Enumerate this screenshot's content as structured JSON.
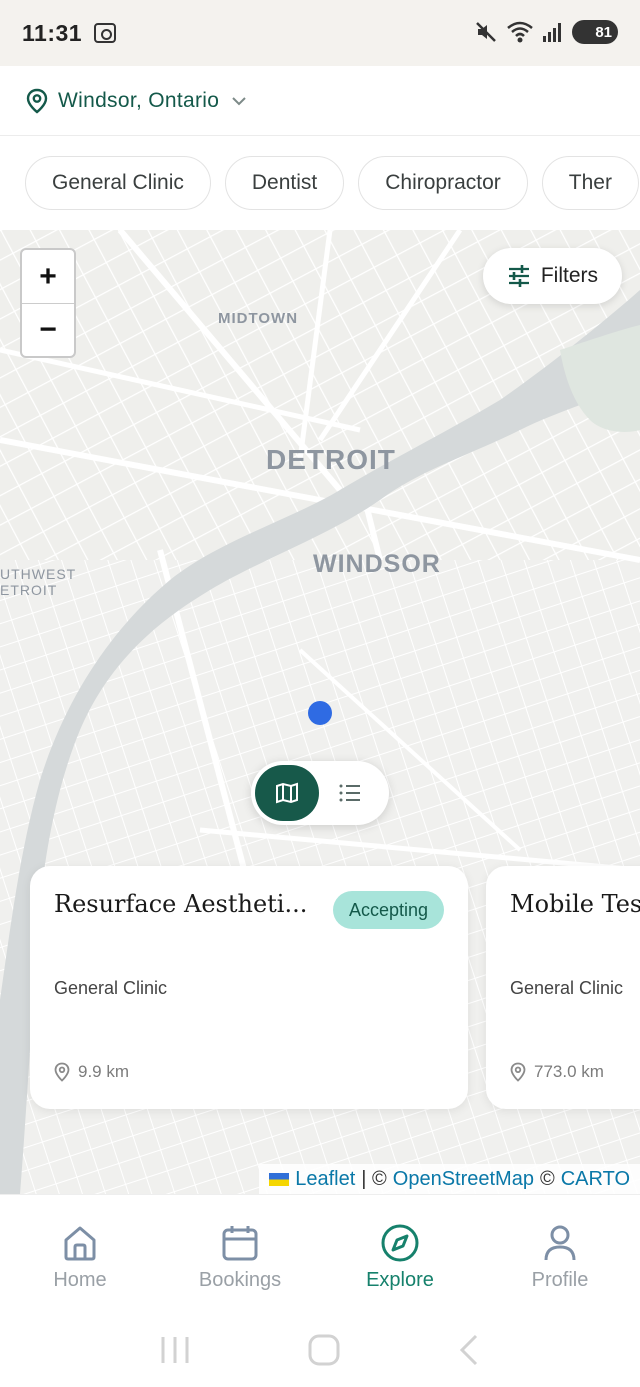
{
  "status_bar": {
    "time": "11:31",
    "battery": "81",
    "icons": [
      "screenshot-icon",
      "mute-icon",
      "wifi-icon",
      "signal-icon",
      "battery-icon"
    ]
  },
  "location": {
    "label": "Windsor, Ontario",
    "icon": "location-pin-icon",
    "accent": "#14594a"
  },
  "categories": [
    "General Clinic",
    "Dentist",
    "Chiropractor",
    "Ther"
  ],
  "map": {
    "labels": {
      "midtown": "MIDTOWN",
      "detroit": "DETROIT",
      "windsor": "WINDSOR",
      "southwest_1": "UTHWEST",
      "southwest_2": "ETROIT"
    },
    "zoom_in": "+",
    "zoom_out": "−",
    "filters_label": "Filters",
    "attribution": {
      "leaflet": "Leaflet",
      "sep1": "| ©",
      "osm": "OpenStreetMap",
      "sep2": "©",
      "carto": "CARTO"
    }
  },
  "cards": [
    {
      "title": "Resurface Aestheti...",
      "badge": "Accepting",
      "type": "General Clinic",
      "distance": "9.9 km"
    },
    {
      "title": "Mobile Tes",
      "type": "General Clinic",
      "distance": "773.0 km"
    }
  ],
  "bottom_nav": [
    {
      "label": "Home",
      "icon": "home-icon"
    },
    {
      "label": "Bookings",
      "icon": "calendar-icon"
    },
    {
      "label": "Explore",
      "icon": "compass-icon",
      "active": true
    },
    {
      "label": "Profile",
      "icon": "user-icon"
    }
  ],
  "colors": {
    "brand_green": "#17594a",
    "active_nav": "#16816c",
    "badge_bg": "#a8e4da",
    "water": "#d6dadb",
    "user_location": "#2f6be3"
  }
}
